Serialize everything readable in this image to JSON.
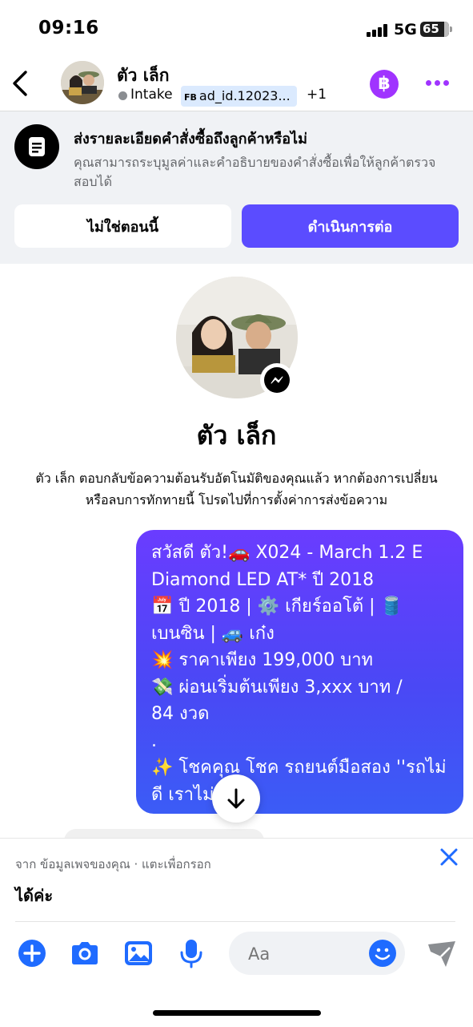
{
  "status_bar": {
    "time": "09:16",
    "network": "5G",
    "battery": "65"
  },
  "header": {
    "contact_name": "ตัว เล็ก",
    "tag_intake": "Intake",
    "tag_ad_prefix": "FB",
    "tag_ad": "ad_id.12023...",
    "tag_more": "+1",
    "coin_symbol": "฿"
  },
  "banner": {
    "title": "ส่งรายละเอียดคำสั่งซื้อถึงลูกค้าหรือไม่",
    "description": "คุณสามารถระบุมูลค่าและคำอธิบายของคำสั่งซื้อเพื่อให้ลูกค้าตรวจสอบได้",
    "not_now_label": "ไม่ใช่ตอนนี้",
    "continue_label": "ดำเนินการต่อ"
  },
  "profile": {
    "name": "ตัว เล็ก",
    "auto_reply_line1": "ตัว เล็ก ตอบกลับข้อความต้อนรับอัตโนมัติของคุณแล้ว หากต้องการเปลี่ยน",
    "auto_reply_line2": "หรือลบการทักทายนี้ โปรดไปที่การตั้งค่าการส่งข้อความ"
  },
  "message": {
    "lines": [
      "สวัสดี ตัว!🚗 X024 - March 1.2 E",
      "Diamond LED AT* ปี 2018",
      "📅 ปี 2018 | ⚙️ เกียร์ออโต้ | 🛢️",
      "เบนซิน | 🚙 เก๋ง",
      "💥 ราคาเพียง 199,000 บาท",
      "💸 ผ่อนเริ่มต้นเพียง 3,xxx บาท /",
      "84 งวด",
      ".",
      "✨ โชคคุณ โชค รถยนต์มือสอง ''รถไม่",
      "ดี เราไม่"
    ]
  },
  "compose": {
    "hint": "จาก ข้อมูลเพจของคุณ · แตะเพื่อกรอก",
    "draft": "ได้ค่ะ",
    "placeholder": "Aa"
  },
  "colors": {
    "accent": "#5b4cff",
    "messenger_blue": "#1f6bff",
    "purple": "#a033ff",
    "banner_bg": "#f0f2f5"
  },
  "icons": [
    "back-chevron-icon",
    "baht-coin-icon",
    "more-dots-icon",
    "document-icon",
    "messenger-icon",
    "arrow-down-icon",
    "close-icon",
    "plus-icon",
    "camera-icon",
    "gallery-icon",
    "microphone-icon",
    "emoji-icon",
    "send-icon"
  ]
}
